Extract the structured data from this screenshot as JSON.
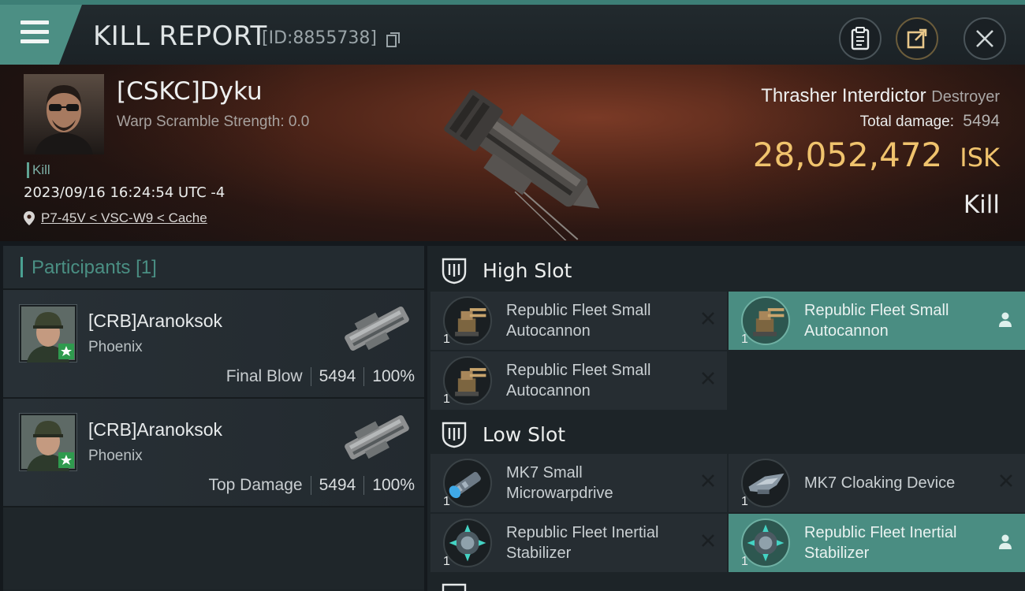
{
  "header": {
    "title": "KILL REPORT",
    "id_text": "[ID:8855738]",
    "menu_icon": "hamburger-menu-icon",
    "buttons": [
      {
        "name": "clipboard-button",
        "icon": "clipboard-icon"
      },
      {
        "name": "share-button",
        "icon": "external-share-icon"
      },
      {
        "name": "close-button",
        "icon": "close-icon"
      }
    ]
  },
  "victim": {
    "name": "[CSKC]Dyku",
    "warp_scramble": "Warp Scramble Strength: 0.0",
    "kill_tag": "Kill",
    "timestamp": "2023/09/16 16:24:54 UTC -4",
    "location": "P7-45V < VSC-W9 < Cache",
    "ship_name": "Thrasher Interdictor",
    "ship_class": "Destroyer",
    "total_damage_label": "Total damage:",
    "total_damage_value": "5494",
    "isk_value": "28,052,472",
    "isk_unit": "ISK",
    "result_label": "Kill"
  },
  "participants": {
    "title": "Participants",
    "count": "[1]",
    "rows": [
      {
        "name": "[CRB]Aranoksok",
        "ship": "Phoenix",
        "stat_label": "Final Blow",
        "damage": "5494",
        "percent": "100%"
      },
      {
        "name": "[CRB]Aranoksok",
        "ship": "Phoenix",
        "stat_label": "Top Damage",
        "damage": "5494",
        "percent": "100%"
      }
    ]
  },
  "fitting": {
    "high_slot_label": "High Slot",
    "low_slot_label": "Low Slot",
    "high_slot": [
      {
        "line1": "Republic Fleet Small",
        "line2": "Autocannon",
        "qty": "1",
        "status": "destroyed"
      },
      {
        "line1": "Republic Fleet Small",
        "line2": "Autocannon",
        "qty": "1",
        "status": "dropped"
      },
      {
        "line1": "Republic Fleet Small",
        "line2": "Autocannon",
        "qty": "1",
        "status": "destroyed"
      }
    ],
    "low_slot": [
      {
        "line1": "MK7 Small",
        "line2": "Microwarpdrive",
        "qty": "1",
        "status": "destroyed"
      },
      {
        "line1": "MK7 Cloaking Device",
        "line2": "",
        "qty": "1",
        "status": "destroyed"
      },
      {
        "line1": "Republic Fleet Inertial",
        "line2": "Stabilizer",
        "qty": "1",
        "status": "destroyed"
      },
      {
        "line1": "Republic Fleet Inertial",
        "line2": "Stabilizer",
        "qty": "1",
        "status": "dropped"
      }
    ]
  },
  "colors": {
    "accent_teal": "#4a8d82",
    "isk_gold": "#f0c36d",
    "panel_dark": "#1d2428"
  }
}
